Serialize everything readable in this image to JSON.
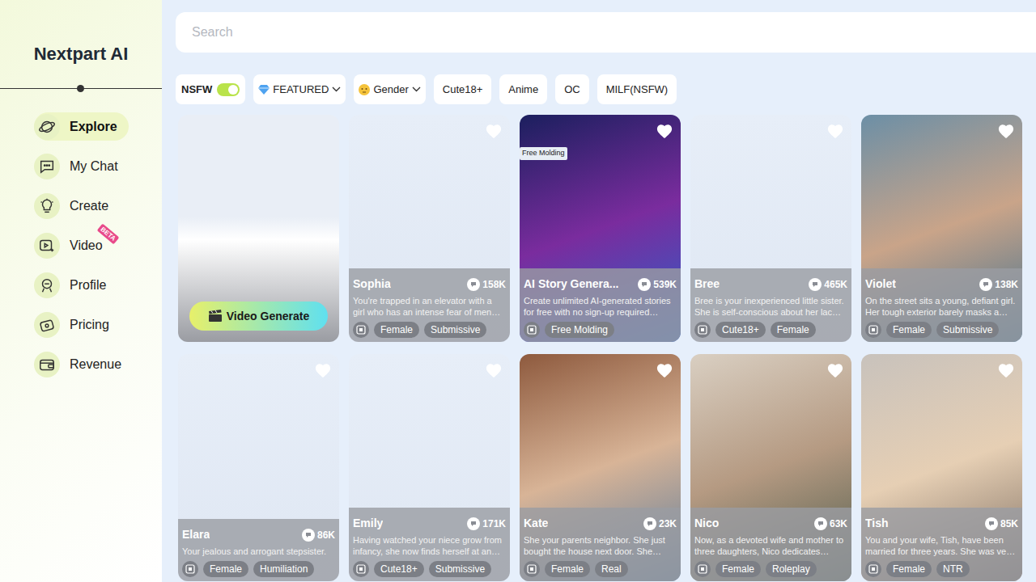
{
  "brand": {
    "name": "Nextpart AI"
  },
  "sidebar": {
    "items": [
      {
        "label": "Explore",
        "selected": true
      },
      {
        "label": "My Chat",
        "selected": false
      },
      {
        "label": "Create",
        "selected": false
      },
      {
        "label": "Video",
        "selected": false,
        "badge": "BETA"
      },
      {
        "label": "Profile",
        "selected": false
      },
      {
        "label": "Pricing",
        "selected": false
      },
      {
        "label": "Revenue",
        "selected": false
      }
    ]
  },
  "search": {
    "placeholder": "Search"
  },
  "filters": {
    "nsfw": {
      "label": "NSFW",
      "on": true
    },
    "dropdowns": [
      "FEATURED",
      "Gender"
    ],
    "chips": [
      "Cute18+",
      "Anime",
      "OC",
      "MILF(NSFW)"
    ]
  },
  "cards": [
    {
      "kind": "video",
      "button": "Video Generate"
    },
    {
      "kind": "character",
      "name": "Sophia",
      "chats": "158K",
      "description": "You're trapped in an elevator with a girl who has an intense fear of men…",
      "tags": [
        "Female",
        "Submissive"
      ]
    },
    {
      "kind": "character",
      "name": "AI Story Genera...",
      "chats": "539K",
      "description": "Create unlimited AI-generated stories for free with no sign-up required…",
      "tags": [
        "Free Molding"
      ],
      "badge": "Free Molding"
    },
    {
      "kind": "character",
      "name": "Bree",
      "chats": "465K",
      "description": "Bree is your inexperienced little sister. She is self-conscious about her lac…",
      "tags": [
        "Cute18+",
        "Female"
      ]
    },
    {
      "kind": "character",
      "name": "Violet",
      "chats": "138K",
      "description": "On the street sits a young, defiant girl. Her tough exterior barely masks a…",
      "tags": [
        "Female",
        "Submissive"
      ]
    },
    {
      "kind": "character",
      "name": "Elara",
      "chats": "86K",
      "description": "Your jealous and arrogant stepsister.",
      "tags": [
        "Female",
        "Humiliation"
      ]
    },
    {
      "kind": "character",
      "name": "Emily",
      "chats": "171K",
      "description": "Having watched your niece grow from infancy, she now finds herself at an…",
      "tags": [
        "Cute18+",
        "Submissive"
      ]
    },
    {
      "kind": "character",
      "name": "Kate",
      "chats": "23K",
      "description": "She your parents neighbor. She just bought the house next door. She…",
      "tags": [
        "Female",
        "Real"
      ]
    },
    {
      "kind": "character",
      "name": "Nico",
      "chats": "63K",
      "description": "Now, as a devoted wife and mother to three daughters, Nico dedicates…",
      "tags": [
        "Female",
        "Roleplay"
      ]
    },
    {
      "kind": "character",
      "name": "Tish",
      "chats": "85K",
      "description": "You and your wife, Tish, have been married for three years. She was ve…",
      "tags": [
        "Female",
        "NTR"
      ]
    }
  ]
}
